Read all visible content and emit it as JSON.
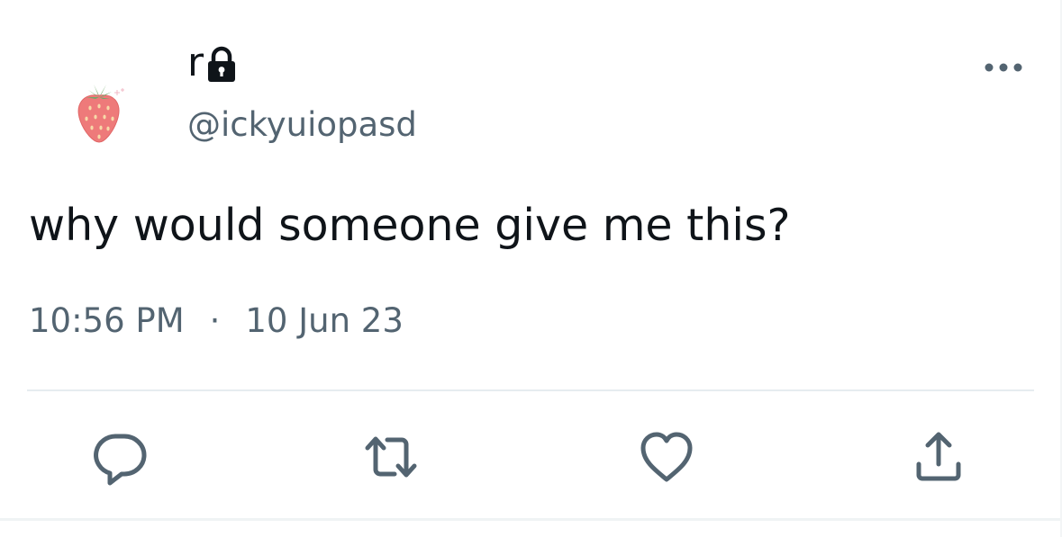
{
  "author": {
    "display_name": "r",
    "handle": "@ickyuiopasd",
    "protected": true,
    "avatar_icon": "strawberry-icon"
  },
  "tweet": {
    "text": "why would someone give me this?",
    "time": "10:56 PM",
    "separator": "·",
    "date": "10 Jun 23"
  },
  "actions": {
    "reply_icon": "reply-icon",
    "retweet_icon": "retweet-icon",
    "like_icon": "heart-icon",
    "share_icon": "share-icon",
    "more_icon": "more-horizontal-icon"
  },
  "colors": {
    "text_primary": "#0f1419",
    "text_secondary": "#536471",
    "icon": "#536471",
    "divider": "#e6ecf0"
  }
}
